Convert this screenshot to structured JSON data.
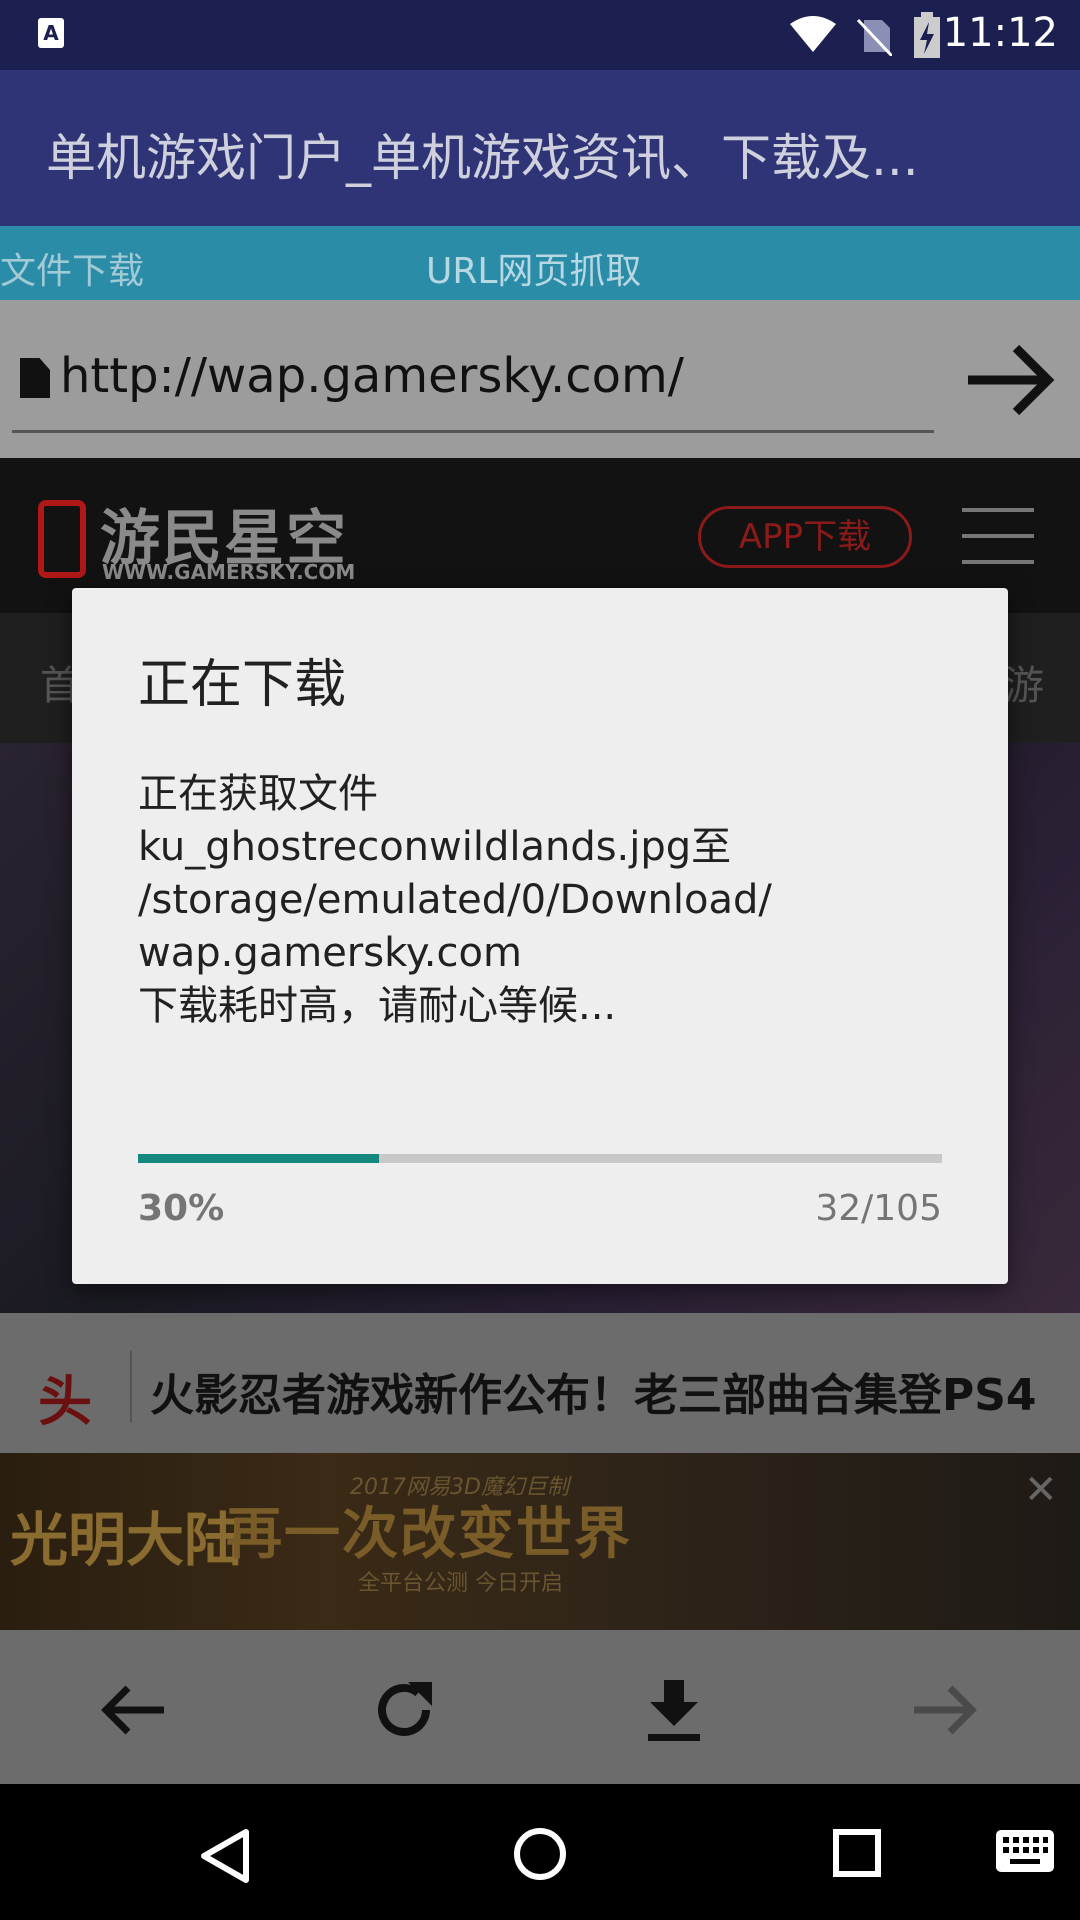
{
  "status_bar": {
    "time": "11:12",
    "app_icon_letter": "A"
  },
  "app_bar": {
    "title": "单机游戏门户_单机游戏资讯、下载及..."
  },
  "tabs": [
    {
      "label": "文件下载"
    },
    {
      "label": "URL网页抓取"
    }
  ],
  "url_bar": {
    "value": "http://wap.gamersky.com/"
  },
  "webpage": {
    "logo_text": "游民星空",
    "logo_sub": "WWW.GAMERSKY.COM",
    "app_button": "APP下载",
    "nav_left": "首",
    "nav_right": "游",
    "news_badge": "头",
    "news_headline": "火影忍者游戏新作公布！老三部曲合集登PS4",
    "ad": {
      "left_text": "光明大陆",
      "main_text": "再一次改变世界",
      "top_text": "2017网易3D魔幻巨制",
      "bottom_text": "全平台公测  今日开启"
    }
  },
  "dialog": {
    "title": "正在下载",
    "message": "正在获取文件\nku_ghostreconwildlands.jpg至\n/storage/emulated/0/Download/\nwap.gamersky.com\n下载耗时高，请耐心等候...",
    "progress_percent_label": "30%",
    "progress_fraction": 0.3,
    "count_label": "32/105",
    "progress_color": "#14877f"
  },
  "toolbar": {
    "icons": [
      "back-arrow-icon",
      "refresh-icon",
      "download-icon",
      "forward-arrow-icon"
    ]
  },
  "nav_bar": {
    "icons": [
      "back-triangle-icon",
      "home-circle-icon",
      "recents-square-icon",
      "keyboard-icon"
    ]
  }
}
